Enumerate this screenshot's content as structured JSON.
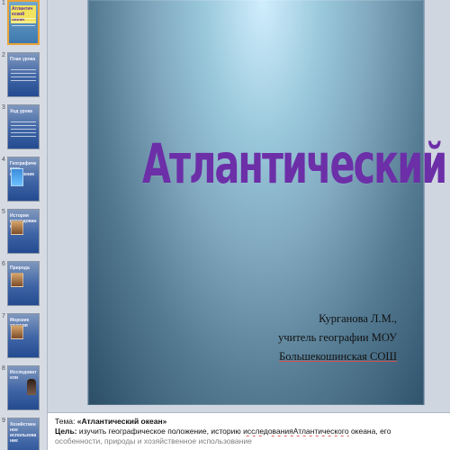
{
  "thumbnails": [
    {
      "number": "1",
      "title": "Атлантический океан"
    },
    {
      "number": "2",
      "title": "План урока"
    },
    {
      "number": "3",
      "title": "Ход урока"
    },
    {
      "number": "4",
      "title": "Географическое положение"
    },
    {
      "number": "5",
      "title": "История исследования"
    },
    {
      "number": "6",
      "title": "Природа"
    },
    {
      "number": "7",
      "title": "Морские течения"
    },
    {
      "number": "8",
      "title": "Исследователи"
    },
    {
      "number": "9",
      "title": "Хозяйственное использование"
    }
  ],
  "slide": {
    "title_main": "Атлантический океан",
    "title_dot": ".",
    "author_line_1": "Курганова Л.М.,",
    "author_line_2": "учитель географии МОУ",
    "author_line_3": "Большекошинская СОШ"
  },
  "notes": {
    "topic_label": "Тема:",
    "topic_value": "«Атлантический океан»",
    "goal_label": "Цель:",
    "goal_text_1": "изучить географическое положение, историю",
    "goal_underlined": "исследованияАтлантического",
    "goal_text_2": "океана, его",
    "goal_text_3": "особенности, природы и хозяйственное использование"
  },
  "colors": {
    "title": "#6c2fa8",
    "dot": "#4368ff",
    "selected_outline": "#e9a33a"
  }
}
